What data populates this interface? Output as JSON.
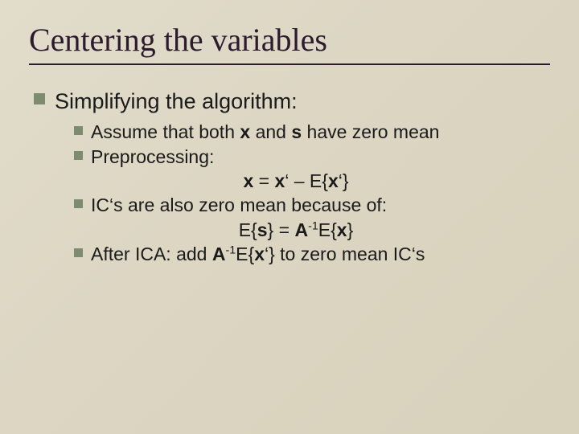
{
  "title": "Centering the variables",
  "lvl1": {
    "text": "Simplifying the algorithm:"
  },
  "b1": {
    "pre": "Assume that both ",
    "x": "x",
    "mid": " and ",
    "s": "s",
    "post": " have zero mean"
  },
  "b2": {
    "text": "Preprocessing:"
  },
  "f1": {
    "x": "x",
    "eq": " = ",
    "xp": "x",
    "prime1": "‘ – E{",
    "x2": "x",
    "prime2": "‘}"
  },
  "b3": {
    "text": "IC‘s are also zero mean because of:"
  },
  "f2": {
    "p1": "E{",
    "s": "s",
    "p2": "} = ",
    "A": "A",
    "sup": "-1",
    "p3": "E{",
    "x": "x",
    "p4": "}"
  },
  "b4": {
    "pre": "After ICA: add ",
    "A": "A",
    "sup": "-1",
    "p1": "E{",
    "x": "x",
    "p2": "‘} to zero mean IC‘s"
  }
}
